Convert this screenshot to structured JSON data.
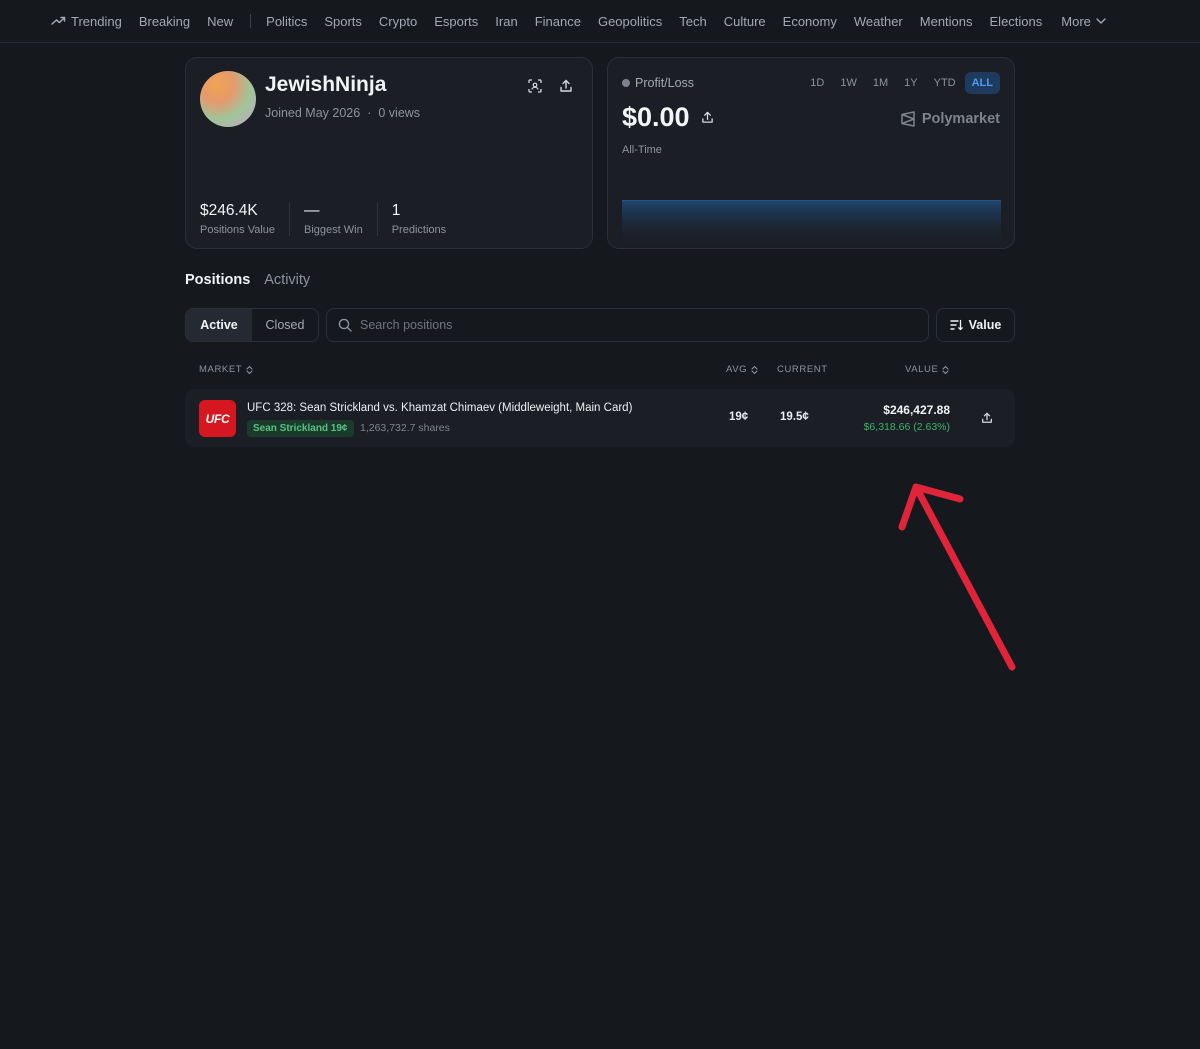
{
  "nav": {
    "items": [
      {
        "label": "Trending",
        "icon": "trending-icon"
      },
      {
        "label": "Breaking"
      },
      {
        "label": "New"
      }
    ],
    "categories": [
      "Politics",
      "Sports",
      "Crypto",
      "Esports",
      "Iran",
      "Finance",
      "Geopolitics",
      "Tech",
      "Culture",
      "Economy",
      "Weather",
      "Mentions",
      "Elections"
    ],
    "more_label": "More"
  },
  "profile": {
    "username": "JewishNinja",
    "joined": "Joined May 2026",
    "separator": "·",
    "views": "0 views",
    "stats": [
      {
        "value": "$246.4K",
        "label": "Positions Value"
      },
      {
        "value": "—",
        "label": "Biggest Win"
      },
      {
        "value": "1",
        "label": "Predictions"
      }
    ]
  },
  "pnl": {
    "title": "Profit/Loss",
    "value": "$0.00",
    "period": "All-Time",
    "brand": "Polymarket",
    "ranges": [
      "1D",
      "1W",
      "1M",
      "1Y",
      "YTD",
      "ALL"
    ],
    "active_range": "ALL",
    "accent_color": "#4e9cf2"
  },
  "tabs": {
    "positions": "Positions",
    "activity": "Activity"
  },
  "filters": {
    "active": "Active",
    "closed": "Closed",
    "search_placeholder": "Search positions",
    "sort_label": "Value"
  },
  "table": {
    "headers": {
      "market": "MARKET",
      "avg": "AVG",
      "current": "CURRENT",
      "value": "VALUE"
    },
    "rows": [
      {
        "logo_text": "UFC",
        "market": "UFC 328: Sean Strickland vs. Khamzat Chimaev (Middleweight, Main Card)",
        "outcome": "Sean Strickland 19¢",
        "shares": "1,263,732.7 shares",
        "avg": "19¢",
        "current": "19.5¢",
        "value": "$246,427.88",
        "gain": "$6,318.66 (2.63%)"
      }
    ]
  },
  "colors": {
    "background": "#15181d",
    "card": "#1b1e24",
    "gain_green": "#3fb36b",
    "annotation_red": "#e0243a"
  }
}
